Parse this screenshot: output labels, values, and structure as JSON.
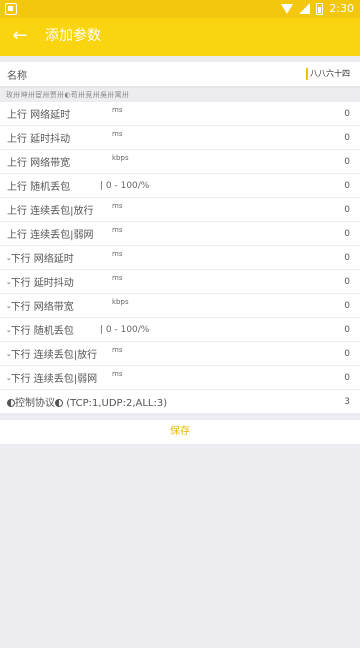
{
  "status": {
    "time": "2:30"
  },
  "appbar": {
    "back_icon": "arrow-left-icon",
    "title": "添加参数"
  },
  "name_field": {
    "label": "名称",
    "value": "八八六十四"
  },
  "garbled_line": "玫卅坤卅宦卅贾卅◐苟卅竞卅吳卅寓卅",
  "params": [
    {
      "label": "上行 网络延时",
      "unit": "ms",
      "range": "",
      "value": "0"
    },
    {
      "label": "上行 延时抖动",
      "unit": "ms",
      "range": "",
      "value": "0"
    },
    {
      "label": "上行 网络带宽",
      "unit": "kbps",
      "range": "",
      "value": "0"
    },
    {
      "label": "上行 随机丢包",
      "unit": "",
      "range": "| 0 - 100/%",
      "value": "0"
    },
    {
      "label": "上行 连续丢包|放行",
      "unit": "ms",
      "range": "",
      "value": "0"
    },
    {
      "label": "上行 连续丢包|弱网",
      "unit": "ms",
      "range": "",
      "value": "0"
    },
    {
      "label": "-下行 网络延时",
      "unit": "ms",
      "range": "",
      "value": "0"
    },
    {
      "label": "-下行 延时抖动",
      "unit": "ms",
      "range": "",
      "value": "0"
    },
    {
      "label": "-下行 网络带宽",
      "unit": "kbps",
      "range": "",
      "value": "0"
    },
    {
      "label": "-下行 随机丢包",
      "unit": "",
      "range": "| 0 - 100/%",
      "value": "0"
    },
    {
      "label": "-下行 连续丢包|放行",
      "unit": "ms",
      "range": "",
      "value": "0"
    },
    {
      "label": "-下行 连续丢包|弱网",
      "unit": "ms",
      "range": "",
      "value": "0"
    }
  ],
  "protocol": {
    "label_text": "控制协议",
    "hint": "(TCP:1,UDP:2,ALL:3)",
    "value": "3"
  },
  "save_label": "保存",
  "colors": {
    "accent": "#fbd410",
    "save_text": "#e6b800"
  }
}
